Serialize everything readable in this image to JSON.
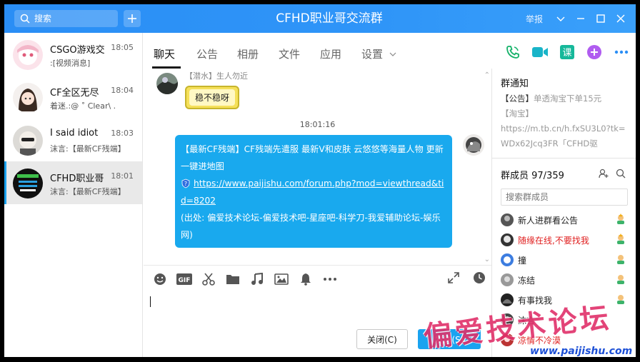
{
  "window": {
    "title": "CFHD职业哥交流群",
    "report_label": "举报",
    "colors": {
      "titlebar": "#2f95f8",
      "accent": "#1aa3f0",
      "bubble": "#19a9ee"
    }
  },
  "search": {
    "placeholder": "搜索"
  },
  "sessions": [
    {
      "name": "CSGO游戏交",
      "time": "18:05",
      "preview": ":[视频消息]"
    },
    {
      "name": "CF全区无尽",
      "time": "18:04",
      "preview": "着迷.:@ ˚ Clear\\ ."
    },
    {
      "name": "I said idiot",
      "time": "18:03",
      "preview": "沫言:【最新CF残端】"
    },
    {
      "name": "CFHD职业哥",
      "time": "18:01",
      "preview": "沫言:【最新CF残端】"
    }
  ],
  "tabs": [
    {
      "label": "聊天"
    },
    {
      "label": "公告"
    },
    {
      "label": "相册"
    },
    {
      "label": "文件"
    },
    {
      "label": "应用"
    },
    {
      "label": "设置"
    }
  ],
  "top_icons": [
    "phone-icon",
    "video-icon",
    "class-icon",
    "add-app-icon",
    "more-icon"
  ],
  "messages": {
    "first": {
      "sender": "【潜水】生人勿近",
      "sticker_text": "稳不稳呀"
    },
    "timestamp": "18:01:16",
    "second": {
      "line1": "【最新CF残端】CF残端先遣服 最新V和皮肤 云悠悠等海量人物 更新一键进地图",
      "link": "https://www.paijishu.com/forum.php?mod=viewthread&tid=8202",
      "source": "(出处: 偏爱技术论坛-偏爱技术吧-星座吧-科学刀-我爱辅助论坛-娱乐网)"
    }
  },
  "toolbar": {
    "left_icons": [
      "emoji-icon",
      "gif-icon",
      "scissors-icon",
      "folder-icon",
      "music-icon",
      "image-icon",
      "bell-icon",
      "more-icon"
    ],
    "right_icons": [
      "expand-icon",
      "history-icon"
    ]
  },
  "input": {
    "close_label": "关闭(C)",
    "send_label": "发送(S)"
  },
  "notice": {
    "title": "群通知",
    "prefix": "【公告】",
    "line1": "单透淘宝下单15元",
    "line2": "【淘宝】",
    "line3": "https://m.tb.cn/h.fxSU3L0?tk=WDx62Jcq3FR「CFHD驱"
  },
  "members": {
    "title": "群成员 97/359",
    "search_placeholder": "搜索群成员",
    "list": [
      {
        "name": "新人进群看公告",
        "red": false
      },
      {
        "name": "随缘在线,不要找我",
        "red": true
      },
      {
        "name": "撞",
        "red": false
      },
      {
        "name": "冻结",
        "red": false
      },
      {
        "name": "有事找我",
        "red": false
      },
      {
        "name": "沫言",
        "red": false
      },
      {
        "name": "凉情不冷漠",
        "red": true
      }
    ]
  },
  "watermark": {
    "text": "偏爱技术论坛",
    "url": "www.paijishu.com"
  }
}
